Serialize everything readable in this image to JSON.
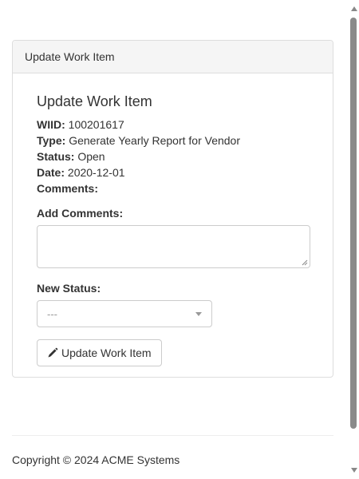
{
  "panel": {
    "heading": "Update Work Item"
  },
  "form": {
    "title": "Update Work Item",
    "wiid_label": "WIID:",
    "wiid_value": "100201617",
    "type_label": "Type:",
    "type_value": "Generate Yearly Report for Vendor",
    "status_label": "Status:",
    "status_value": "Open",
    "date_label": "Date:",
    "date_value": "2020-12-01",
    "comments_label": "Comments:",
    "comments_value": "",
    "add_comments_label": "Add Comments:",
    "add_comments_value": "",
    "new_status_label": "New Status:",
    "new_status_selected": "---",
    "submit_label": "Update Work Item"
  },
  "footer": {
    "copyright": "Copyright © 2024 ACME Systems"
  },
  "icons": {
    "submit_icon": "pencil-icon",
    "select_icon": "chevron-down-icon"
  }
}
